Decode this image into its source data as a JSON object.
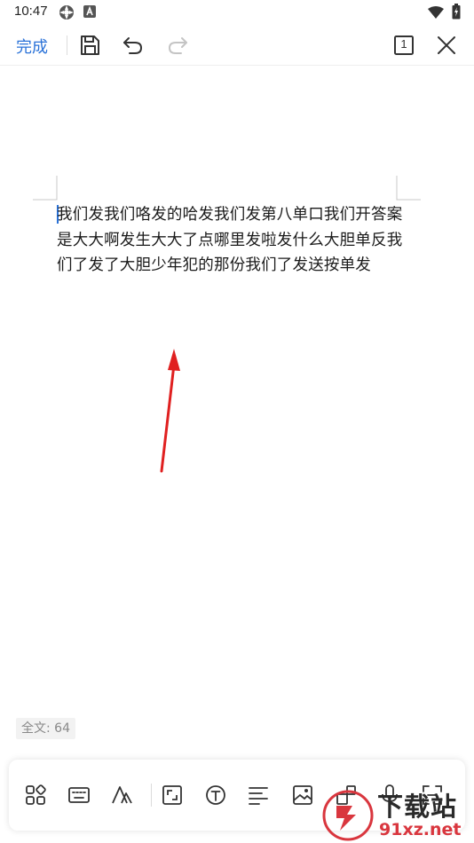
{
  "status_bar": {
    "time": "10:47",
    "icons": [
      "settings-gear-icon",
      "a-badge-icon",
      "wifi-icon",
      "battery-icon"
    ]
  },
  "toolbar": {
    "done_label": "完成",
    "icons": [
      "save-icon",
      "undo-icon",
      "redo-icon",
      "page-count-icon",
      "close-icon"
    ],
    "page_number": "1",
    "accent_color": "#2a72d8"
  },
  "document": {
    "text": "我们发我们咯发的哈发我们发第八单口我们开答案是大大啊发生大大了点哪里发啦发什么大胆单反我们了发了大胆少年犯的那份我们了发送按单发"
  },
  "word_count": {
    "label": "全文: 64"
  },
  "bottom_toolbar": {
    "icons": [
      "apps-grid-icon",
      "keyboard-icon",
      "text-style-icon",
      "fullscreen-icon",
      "text-box-icon",
      "align-icon",
      "image-icon",
      "shape-icon",
      "microphone-icon",
      "scan-icon"
    ]
  },
  "watermark": {
    "text_top": "下载站",
    "text_bottom": "91xz.net"
  }
}
